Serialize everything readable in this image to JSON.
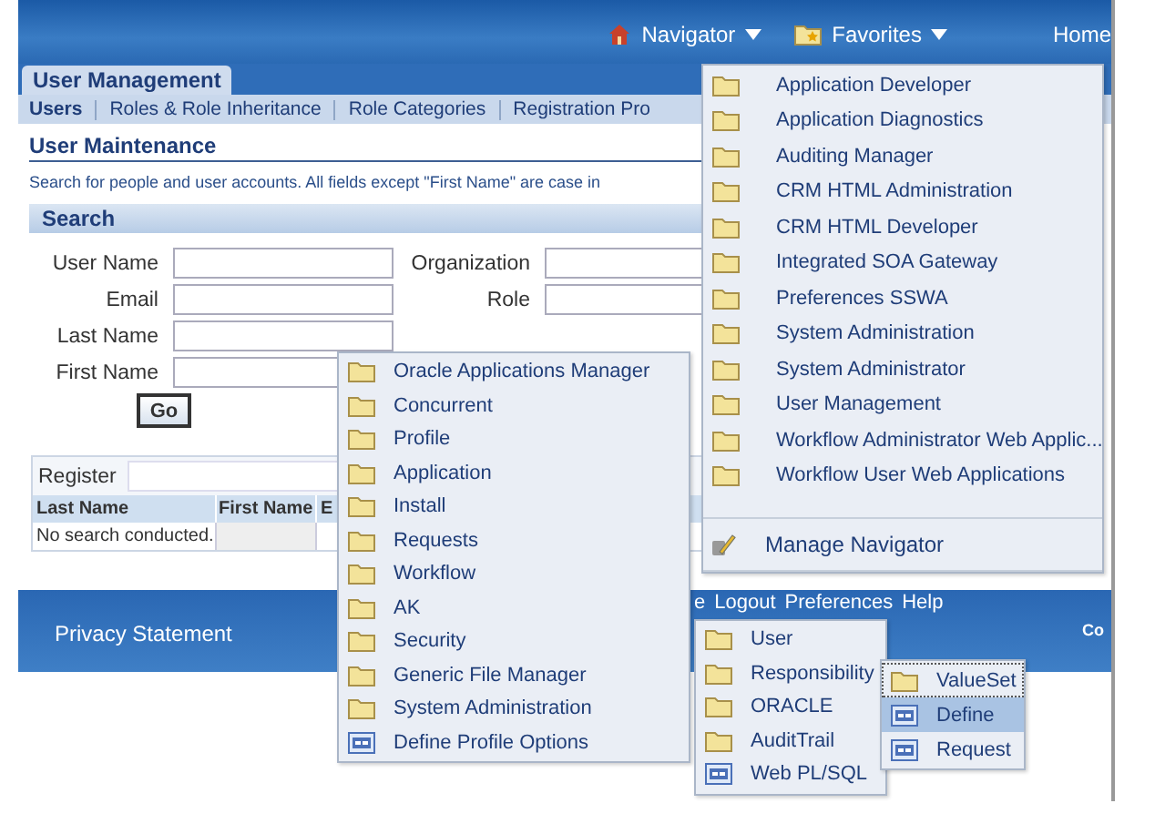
{
  "header": {
    "navigator": "Navigator",
    "favorites": "Favorites",
    "home": "Home"
  },
  "tabs": [
    {
      "label": "User Management",
      "selected": true
    }
  ],
  "subtabs": [
    {
      "label": "Users",
      "selected": true
    },
    {
      "label": "Roles & Role Inheritance",
      "selected": false
    },
    {
      "label": "Role Categories",
      "selected": false
    },
    {
      "label": "Registration Pro",
      "selected": false
    }
  ],
  "section_title": "User Maintenance",
  "description": "Search for people and user accounts. All fields except \"First Name\" are case in",
  "search": {
    "title": "Search",
    "fields_left": [
      {
        "label": "User Name"
      },
      {
        "label": "Email"
      },
      {
        "label": "Last Name"
      },
      {
        "label": "First Name"
      }
    ],
    "fields_right": [
      {
        "label": "Organization"
      },
      {
        "label": "Role"
      }
    ],
    "button": "Go"
  },
  "results": {
    "register_label": "Register",
    "columns": [
      "Last Name",
      "First Name",
      "E"
    ],
    "empty_message": "No search conducted."
  },
  "footer": {
    "links": [
      "e",
      "Logout",
      "Preferences",
      "Help"
    ],
    "privacy": "Privacy Statement",
    "copyright": "Co"
  },
  "navigator_menu": {
    "items": [
      {
        "label": "Application Developer",
        "kind": "folder"
      },
      {
        "label": "Application Diagnostics",
        "kind": "folder"
      },
      {
        "label": "Auditing Manager",
        "kind": "folder"
      },
      {
        "label": "CRM HTML Administration",
        "kind": "folder"
      },
      {
        "label": "CRM HTML Developer",
        "kind": "folder"
      },
      {
        "label": "Integrated SOA Gateway",
        "kind": "folder"
      },
      {
        "label": "Preferences SSWA",
        "kind": "folder"
      },
      {
        "label": "System Administration",
        "kind": "folder"
      },
      {
        "label": "System Administrator",
        "kind": "folder"
      },
      {
        "label": "User Management",
        "kind": "folder"
      },
      {
        "label": "Workflow Administrator Web Applic...",
        "kind": "folder"
      },
      {
        "label": "Workflow User Web Applications",
        "kind": "folder"
      }
    ],
    "manage": "Manage Navigator"
  },
  "submenus": [
    {
      "items": [
        {
          "label": "Oracle Applications Manager",
          "kind": "folder",
          "selected": false,
          "focused": false
        },
        {
          "label": "Concurrent",
          "kind": "folder",
          "selected": false,
          "focused": false
        },
        {
          "label": "Profile",
          "kind": "folder",
          "selected": false,
          "focused": false
        },
        {
          "label": "Application",
          "kind": "folder",
          "selected": false,
          "focused": false
        },
        {
          "label": "Install",
          "kind": "folder",
          "selected": false,
          "focused": false
        },
        {
          "label": "Requests",
          "kind": "folder",
          "selected": false,
          "focused": false
        },
        {
          "label": "Workflow",
          "kind": "folder",
          "selected": false,
          "focused": false
        },
        {
          "label": "AK",
          "kind": "folder",
          "selected": false,
          "focused": false
        },
        {
          "label": "Security",
          "kind": "folder",
          "selected": false,
          "focused": false
        },
        {
          "label": "Generic File Manager",
          "kind": "folder",
          "selected": false,
          "focused": false
        },
        {
          "label": "System Administration",
          "kind": "folder",
          "selected": false,
          "focused": false
        },
        {
          "label": "Define Profile Options",
          "kind": "form",
          "selected": false,
          "focused": false
        }
      ]
    },
    {
      "items": [
        {
          "label": "User",
          "kind": "folder",
          "selected": false,
          "focused": false
        },
        {
          "label": "Responsibility",
          "kind": "folder",
          "selected": false,
          "focused": false
        },
        {
          "label": "ORACLE",
          "kind": "folder",
          "selected": false,
          "focused": false
        },
        {
          "label": "AuditTrail",
          "kind": "folder",
          "selected": false,
          "focused": false
        },
        {
          "label": "Web PL/SQL",
          "kind": "form",
          "selected": false,
          "focused": false
        }
      ]
    },
    {
      "items": [
        {
          "label": "ValueSet",
          "kind": "folder",
          "selected": false,
          "focused": true
        },
        {
          "label": "Define",
          "kind": "form",
          "selected": true,
          "focused": false
        },
        {
          "label": "Request",
          "kind": "form",
          "selected": false,
          "focused": false
        }
      ]
    }
  ]
}
